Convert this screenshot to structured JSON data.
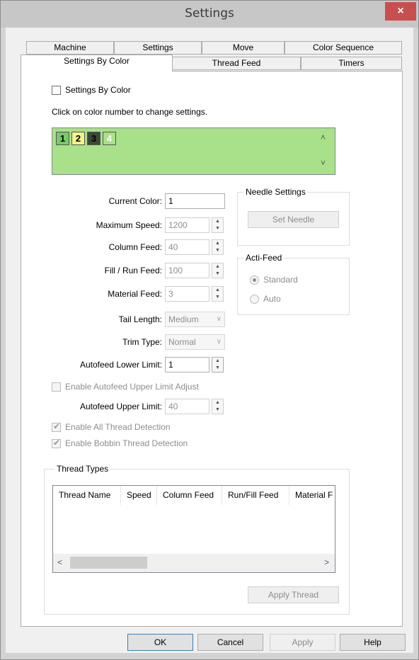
{
  "window": {
    "title": "Settings",
    "close": "×"
  },
  "tabs_row1": [
    "Machine",
    "Settings",
    "Move",
    "Color Sequence"
  ],
  "tabs_row2": [
    "Settings By Color",
    "Thread Feed",
    "Timers"
  ],
  "settings_by_color": {
    "checkbox_label": "Settings By Color",
    "hint": "Click on color number to change settings.",
    "swatches": [
      {
        "label": "1",
        "color": "#a9e08a"
      },
      {
        "label": "2",
        "color": "#78c96a"
      },
      {
        "label": "3",
        "color": "#f3f38b"
      },
      {
        "label": "4",
        "color": "#3b4a34"
      }
    ],
    "scroll_up": "˄",
    "scroll_down": "˅"
  },
  "fields": {
    "current_color": {
      "label": "Current Color:",
      "value": "1"
    },
    "max_speed": {
      "label": "Maximum Speed:",
      "value": "1200"
    },
    "column_feed": {
      "label": "Column Feed:",
      "value": "40"
    },
    "fill_run_feed": {
      "label": "Fill / Run Feed:",
      "value": "100"
    },
    "material_feed": {
      "label": "Material Feed:",
      "value": "3"
    },
    "tail_length": {
      "label": "Tail Length:",
      "value": "Medium"
    },
    "trim_type": {
      "label": "Trim Type:",
      "value": "Normal"
    },
    "autofeed_lower": {
      "label": "Autofeed Lower Limit:",
      "value": "1"
    },
    "enable_autofeed_upper": "Enable Autofeed Upper Limit Adjust",
    "autofeed_upper": {
      "label": "Autofeed Upper Limit:",
      "value": "40"
    },
    "enable_all_thread_detection": "Enable All Thread Detection",
    "enable_bobbin_detection": "Enable Bobbin Thread Detection"
  },
  "needle_settings": {
    "title": "Needle Settings",
    "button": "Set Needle"
  },
  "acti_feed": {
    "title": "Acti-Feed",
    "options": [
      "Standard",
      "Auto"
    ],
    "selected": "Standard"
  },
  "thread_types": {
    "title": "Thread Types",
    "columns": [
      "Thread Name",
      "Speed",
      "Column Feed",
      "Run/Fill Feed",
      "Material F"
    ],
    "apply_button": "Apply Thread",
    "scroll_left": "<",
    "scroll_right": ">"
  },
  "footer": {
    "ok": "OK",
    "cancel": "Cancel",
    "apply": "Apply",
    "help": "Help"
  }
}
